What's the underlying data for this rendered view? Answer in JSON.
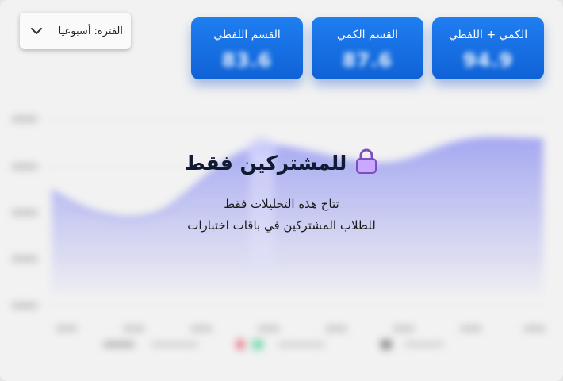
{
  "period": {
    "label": "الفترة: أسبوعيا"
  },
  "cards": [
    {
      "title": "الكمي + اللفظي",
      "value": "94.9"
    },
    {
      "title": "القسم الكمي",
      "value": "87.6"
    },
    {
      "title": "القسم اللفظي",
      "value": "83.6"
    }
  ],
  "overlay": {
    "title": "للمشتركين فقط",
    "line1": "تتاح هذه التحليلات فقط",
    "line2": "للطلاب المشتركين في باقات اختبارات"
  },
  "colors": {
    "card": "#1a73e8",
    "area": "#7b7ff0",
    "text": "#0f1b33"
  },
  "icons": {
    "dropdown": "chevron-down-icon",
    "lock": "lock-icon"
  }
}
